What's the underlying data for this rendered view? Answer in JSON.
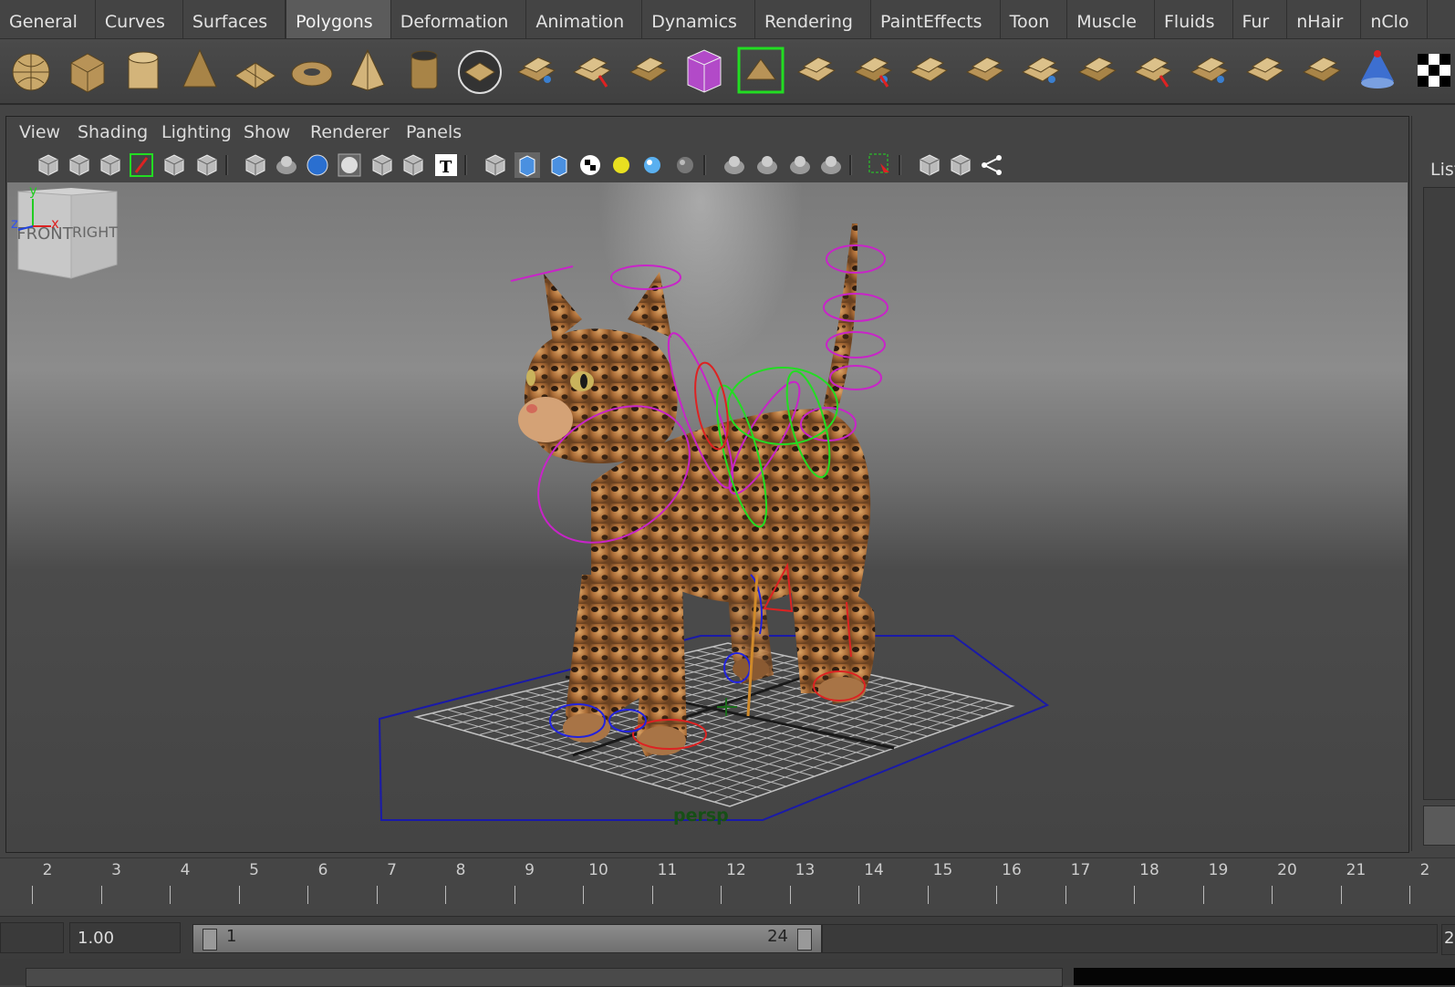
{
  "shelf": {
    "tabs": [
      {
        "label": "General",
        "active": false
      },
      {
        "label": "Curves",
        "active": false
      },
      {
        "label": "Surfaces",
        "active": false
      },
      {
        "label": "Polygons",
        "active": true
      },
      {
        "label": "Deformation",
        "active": false
      },
      {
        "label": "Animation",
        "active": false
      },
      {
        "label": "Dynamics",
        "active": false
      },
      {
        "label": "Rendering",
        "active": false
      },
      {
        "label": "PaintEffects",
        "active": false
      },
      {
        "label": "Toon",
        "active": false
      },
      {
        "label": "Muscle",
        "active": false
      },
      {
        "label": "Fluids",
        "active": false
      },
      {
        "label": "Fur",
        "active": false
      },
      {
        "label": "nHair",
        "active": false
      },
      {
        "label": "nClo",
        "active": false
      }
    ],
    "icons": [
      "poly-sphere-icon",
      "poly-cube-icon",
      "poly-cylinder-icon",
      "poly-cone-icon",
      "poly-plane-icon",
      "poly-torus-icon",
      "poly-pyramid-icon",
      "poly-pipe-icon",
      "poly-helix-icon",
      "separate-icon",
      "combine-icon",
      "extract-icon",
      "smooth-proxy-icon",
      "bridge-icon",
      "select-faces-icon",
      "extrude-icon",
      "merge-icon",
      "bevel-icon",
      "append-icon",
      "split-polygon-icon",
      "insert-edge-loop-icon",
      "offset-edge-icon",
      "wedge-icon",
      "poke-icon",
      "uv-layout-icon",
      "checker-icon"
    ]
  },
  "panel": {
    "menu": [
      "View",
      "Shading",
      "Lighting",
      "Show",
      "Renderer",
      "Panels"
    ],
    "camera_name": "persp",
    "view_cube": {
      "front": "FRONT",
      "right": "RIGHT"
    },
    "axis": {
      "y": "y",
      "z": "z",
      "x": "x"
    }
  },
  "right_panel": {
    "label": "List"
  },
  "time_slider": {
    "ticks": [
      "2",
      "3",
      "4",
      "5",
      "6",
      "7",
      "8",
      "9",
      "10",
      "11",
      "12",
      "13",
      "14",
      "15",
      "16",
      "17",
      "18",
      "19",
      "20",
      "21",
      "2"
    ]
  },
  "range_slider": {
    "start_field": "",
    "current": "1.00",
    "range_start": "1",
    "range_end": "24",
    "end_field": "2"
  },
  "colors": {
    "control_magenta": "#c824c8",
    "control_green": "#22dd22",
    "control_red": "#dd2222",
    "control_blue": "#1a1aa8",
    "camera_label": "#164f16"
  }
}
